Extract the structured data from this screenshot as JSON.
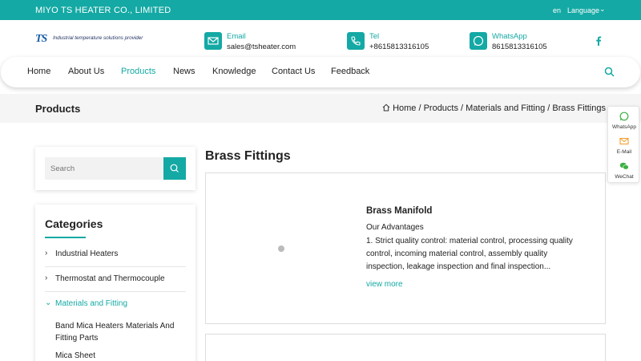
{
  "topbar": {
    "company": "MIYO TS HEATER CO., LIMITED",
    "lang_code": "en",
    "language": "Language"
  },
  "logo": {
    "mark": "TS",
    "tagline": "Industrial temperature solutions provider"
  },
  "contacts": {
    "email": {
      "label": "Email",
      "value": "sales@tsheater.com"
    },
    "tel": {
      "label": "Tel",
      "value": "+8615813316105"
    },
    "whatsapp": {
      "label": "WhatsApp",
      "value": "8615813316105"
    }
  },
  "nav": {
    "items": [
      "Home",
      "About Us",
      "Products",
      "News",
      "Knowledge",
      "Contact Us",
      "Feedback"
    ],
    "active": "Products"
  },
  "titlebar": {
    "title": "Products",
    "breadcrumb": "Home / Products / Materials and Fitting / Brass Fittings"
  },
  "sidebar": {
    "search_placeholder": "Search",
    "categories_heading": "Categories",
    "categories": [
      "Industrial Heaters",
      "Thermostat and Thermocouple",
      "Materials and Fitting"
    ],
    "subcategories": [
      "Band Mica Heaters Materials And Fitting Parts",
      "Mica Sheet"
    ]
  },
  "main": {
    "section_title": "Brass Fittings",
    "product": {
      "name": "Brass Manifold",
      "advantages": "Our Advantages",
      "description": "1. Strict quality control: material control, processing quality control, incoming material control, assembly quality inspection, leakage inspection and final inspection...",
      "more": "view more"
    }
  },
  "float_bar": {
    "whatsapp": "WhatsApp",
    "email": "E-Mail",
    "wechat": "WeChat"
  },
  "colors": {
    "accent": "#14a9a4"
  }
}
